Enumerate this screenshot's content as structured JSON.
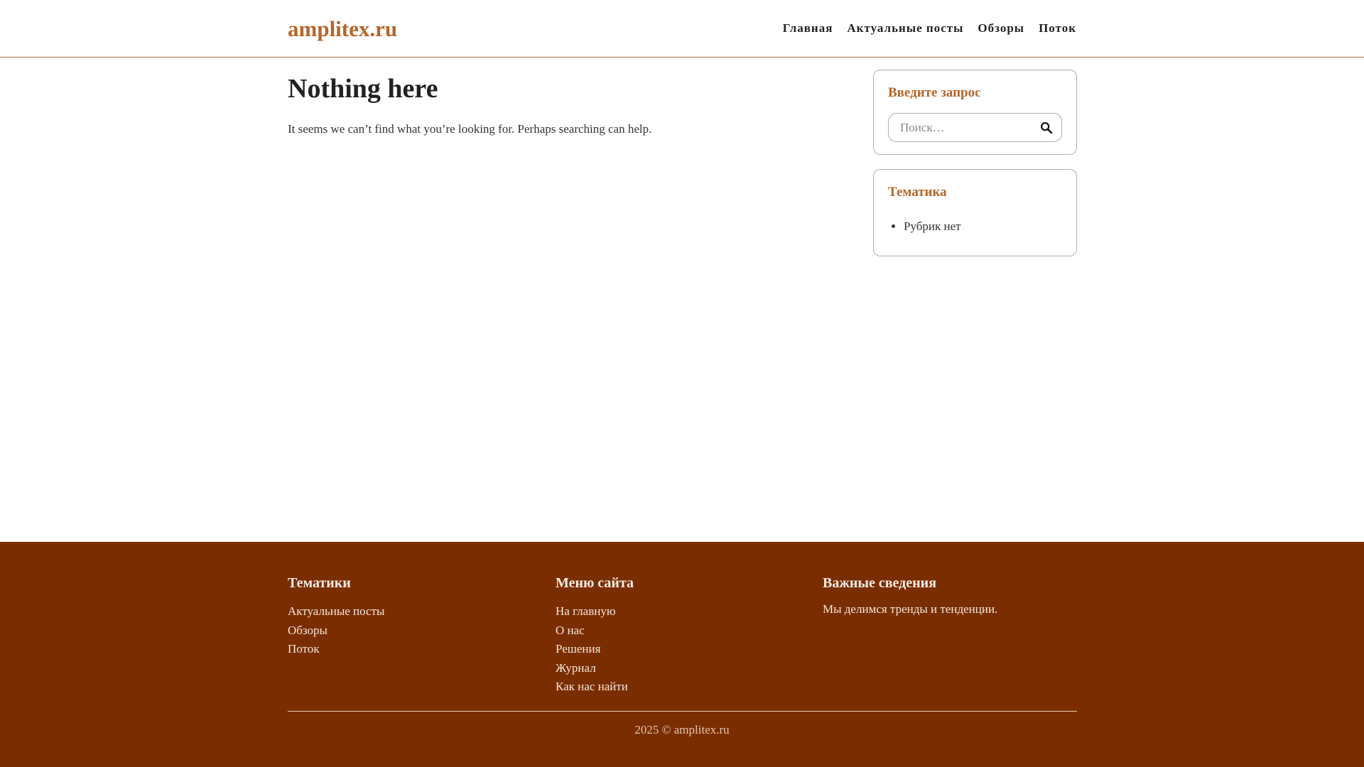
{
  "header": {
    "logo": "amplitex.ru",
    "nav": [
      "Главная",
      "Актуальные посты",
      "Обзоры",
      "Поток"
    ]
  },
  "main": {
    "title": "Nothing here",
    "text": "It seems we can’t find what you’re looking for. Perhaps searching can help."
  },
  "sidebar": {
    "search": {
      "title": "Введите запрос",
      "placeholder": "Поиск…"
    },
    "topics": {
      "title": "Тематика",
      "items": [
        "Рубрик нет"
      ]
    }
  },
  "footer": {
    "col1": {
      "heading": "Тематики",
      "links": [
        "Актуальные посты",
        "Обзоры",
        "Поток"
      ]
    },
    "col2": {
      "heading": "Меню сайта",
      "links": [
        "На главную",
        "О нас",
        "Решения",
        "Журнал",
        "Как нас найти"
      ]
    },
    "col3": {
      "heading": "Важные сведения",
      "text": "Мы делимся тренды и тенденции."
    },
    "copyright": "2025 © amplitex.ru"
  },
  "colors": {
    "accent": "#b5652a",
    "footer_bg": "#7a2e00"
  },
  "icons": {
    "search_button": "search-icon"
  }
}
